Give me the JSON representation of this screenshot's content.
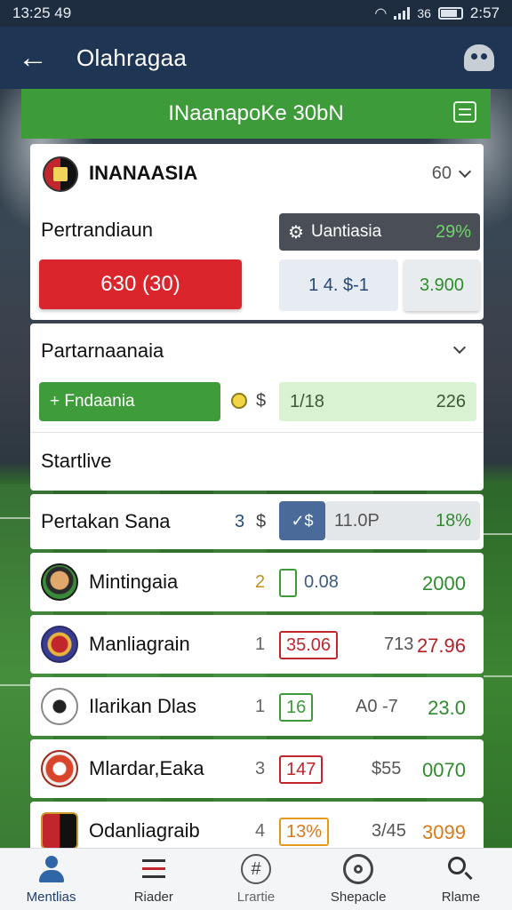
{
  "status_bar": {
    "time_left": "13:25 49",
    "network": "36",
    "time_right": "2:57"
  },
  "app_bar": {
    "title": "Olahragaa",
    "back_icon": "arrow-left-icon",
    "profile_icon": "ghost-icon"
  },
  "banner": {
    "title": "INaanapoKe 30bN",
    "icon": "list-icon"
  },
  "featured": {
    "team": "INANAASIA",
    "count": "60",
    "section_label": "Pertrandiaun",
    "live_pill": {
      "label": "Uantiasia",
      "value": "29%"
    },
    "main_bet": "630 (30)",
    "odds_a": "1 4. $-1",
    "odds_b": "3.900"
  },
  "second": {
    "section_label": "Partarnaanaia",
    "green_button": "+ Fndaania",
    "coin_label": "$",
    "progress_left": "1/18",
    "progress_right": "226",
    "startlive": "Startlive"
  },
  "header_row": {
    "label": "Pertakan Sana",
    "num": "3",
    "currency": "$",
    "check_label": "✓$",
    "mid": "11.0P",
    "value": "18%"
  },
  "rows": [
    {
      "name": "Mintingaia",
      "num": "2",
      "box": "0.08",
      "box_color": "#3d9b3a",
      "mid": "",
      "value": "2000",
      "value_color": "#2f8b2d",
      "num_color": "#c0901a"
    },
    {
      "name": "Manliagrain",
      "num": "1",
      "box": "35.06",
      "box_color": "#c0262c",
      "mid": "713",
      "value": "27.96",
      "value_color": "#b32227",
      "num_color": "#666"
    },
    {
      "name": "Ilarikan Dlas",
      "num": "1",
      "box": "16",
      "box_color": "#3d9b3a",
      "mid": "A0 -7",
      "value": "23.0",
      "value_color": "#2f8b2d",
      "num_color": "#666"
    },
    {
      "name": "Mlardar,Eaka",
      "num": "3",
      "box": "147",
      "box_color": "#c0262c",
      "mid": "$55",
      "value": "0070",
      "value_color": "#2f8b2d",
      "num_color": "#666"
    },
    {
      "name": "Odanliagraib",
      "num": "4",
      "box": "13%",
      "box_color": "#e39a1c",
      "mid": "3/45",
      "value": "3099",
      "value_color": "#d9791a",
      "num_color": "#666"
    }
  ],
  "bottom_nav": [
    {
      "label": "Mentlias",
      "icon": "user-icon",
      "active": true
    },
    {
      "label": "Riader",
      "icon": "menu-icon",
      "active": false
    },
    {
      "label": "Lrartie",
      "icon": "hash-icon",
      "active": false
    },
    {
      "label": "Shepacle",
      "icon": "pin-icon",
      "active": false
    },
    {
      "label": "Rlame",
      "icon": "search-icon",
      "active": false
    }
  ]
}
